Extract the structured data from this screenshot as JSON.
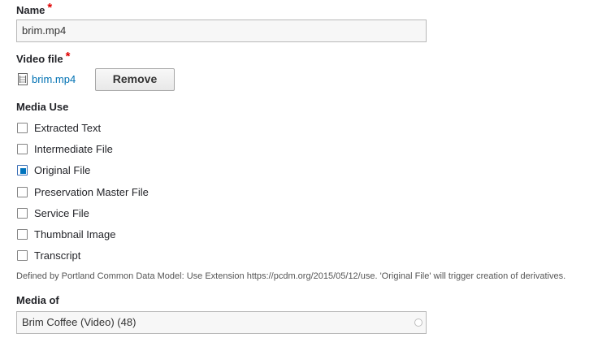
{
  "name_field": {
    "label": "Name",
    "required_mark": "*",
    "value": "brim.mp4"
  },
  "video_file": {
    "label": "Video file",
    "required_mark": "*",
    "file_name": "brim.mp4",
    "file_icon": "file-document-icon",
    "remove_label": "Remove"
  },
  "media_use": {
    "label": "Media Use",
    "options": [
      {
        "label": "Extracted Text",
        "checked": false
      },
      {
        "label": "Intermediate File",
        "checked": false
      },
      {
        "label": "Original File",
        "checked": true
      },
      {
        "label": "Preservation Master File",
        "checked": false
      },
      {
        "label": "Service File",
        "checked": false
      },
      {
        "label": "Thumbnail Image",
        "checked": false
      },
      {
        "label": "Transcript",
        "checked": false
      }
    ],
    "description": "Defined by Portland Common Data Model: Use Extension https://pcdm.org/2015/05/12/use. 'Original File' will trigger creation of derivatives."
  },
  "media_of": {
    "label": "Media of",
    "value": "Brim Coffee (Video) (48)",
    "autocomplete_icon": "autocomplete-throbber-icon"
  },
  "colors": {
    "link": "#0071b3",
    "required": "#e00000",
    "checkbox_checked": "#0074bd"
  }
}
